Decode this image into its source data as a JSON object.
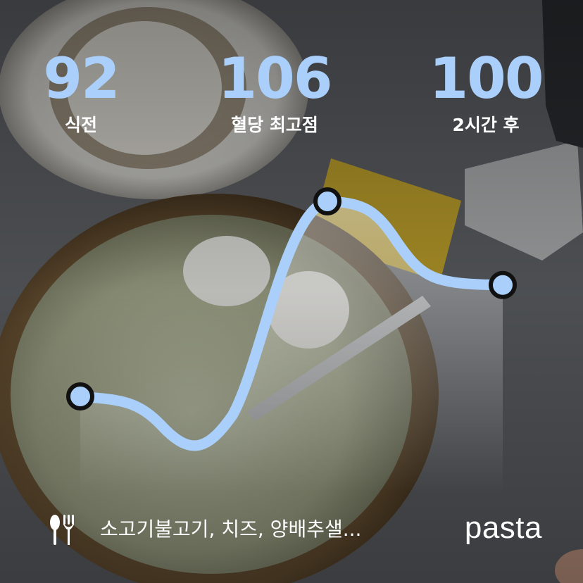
{
  "stats": {
    "before": {
      "value": "92",
      "label": "식전"
    },
    "peak": {
      "value": "106",
      "label": "혈당 최고점"
    },
    "after": {
      "value": "100",
      "label": "2시간 후"
    }
  },
  "meal": {
    "icon": "utensils-icon",
    "text": "소고기불고기, 치즈, 양배추샐..."
  },
  "brand": "pasta",
  "colors": {
    "accent": "#a9cffa",
    "text": "#ffffff",
    "marker_outline": "#111111"
  },
  "chart_data": {
    "type": "line",
    "series": [
      {
        "points": [
          {
            "x": "식전",
            "y": 92
          },
          {
            "x": "혈당 최고점",
            "y": 106
          },
          {
            "x": "2시간 후",
            "y": 100
          }
        ]
      }
    ],
    "markers": [
      "식전",
      "혈당 최고점",
      "2시간 후"
    ]
  }
}
